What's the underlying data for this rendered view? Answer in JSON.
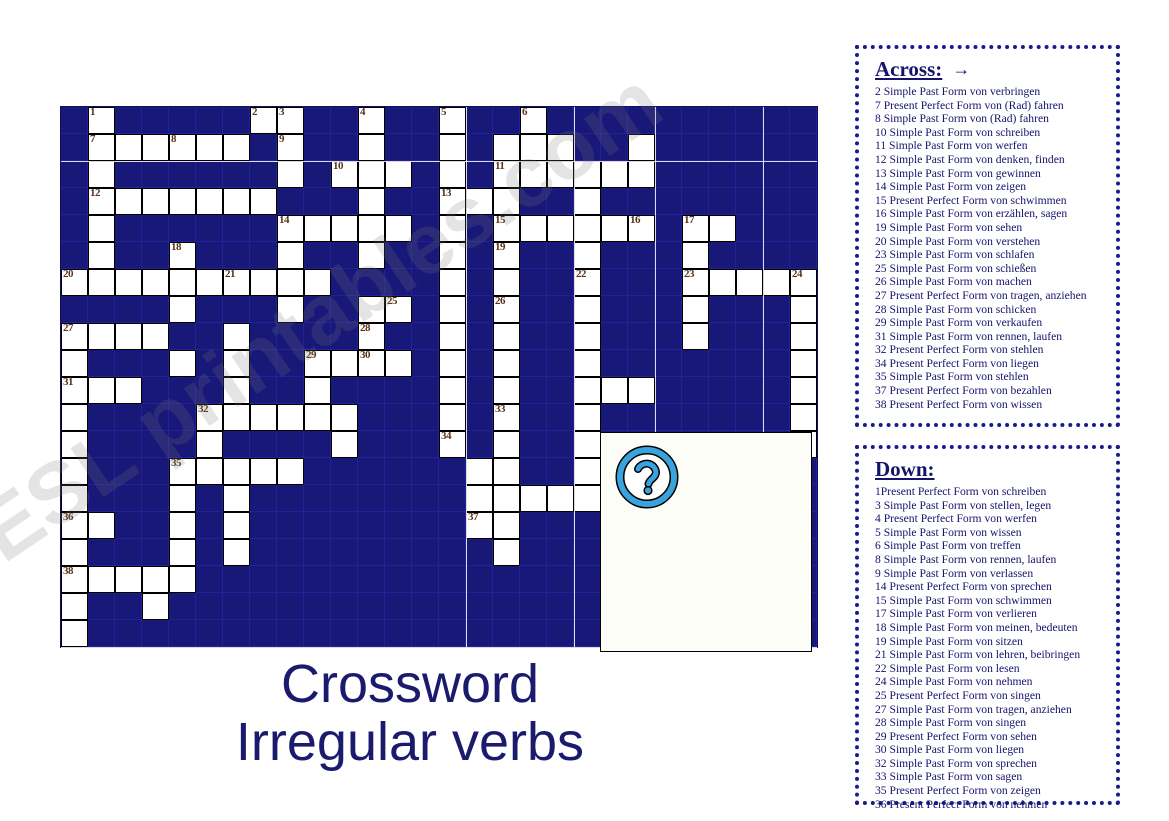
{
  "title": {
    "line1": "Crossword",
    "line2": "Irregular verbs"
  },
  "watermark": "ESL printables.com",
  "grid": {
    "columns": 28,
    "rows": 20,
    "cell_size": 27,
    "blocked_color": "#181878",
    "open_color": "#ffffff",
    "number_color": "#5a3318",
    "open_cells": [
      [
        0,
        1
      ],
      [
        0,
        7
      ],
      [
        0,
        8
      ],
      [
        0,
        11
      ],
      [
        0,
        14
      ],
      [
        0,
        17
      ],
      [
        1,
        1
      ],
      [
        1,
        2
      ],
      [
        1,
        3
      ],
      [
        1,
        4
      ],
      [
        1,
        5
      ],
      [
        1,
        6
      ],
      [
        1,
        8
      ],
      [
        1,
        11
      ],
      [
        1,
        14
      ],
      [
        1,
        16
      ],
      [
        1,
        17
      ],
      [
        1,
        18
      ],
      [
        1,
        21
      ],
      [
        2,
        1
      ],
      [
        2,
        8
      ],
      [
        2,
        10
      ],
      [
        2,
        11
      ],
      [
        2,
        12
      ],
      [
        2,
        14
      ],
      [
        2,
        16
      ],
      [
        2,
        17
      ],
      [
        2,
        18
      ],
      [
        2,
        19
      ],
      [
        2,
        20
      ],
      [
        2,
        21
      ],
      [
        3,
        1
      ],
      [
        3,
        2
      ],
      [
        3,
        3
      ],
      [
        3,
        4
      ],
      [
        3,
        5
      ],
      [
        3,
        6
      ],
      [
        3,
        7
      ],
      [
        3,
        11
      ],
      [
        3,
        14
      ],
      [
        3,
        15
      ],
      [
        3,
        16
      ],
      [
        3,
        19
      ],
      [
        4,
        1
      ],
      [
        4,
        8
      ],
      [
        4,
        9
      ],
      [
        4,
        10
      ],
      [
        4,
        11
      ],
      [
        4,
        12
      ],
      [
        4,
        14
      ],
      [
        4,
        16
      ],
      [
        4,
        17
      ],
      [
        4,
        18
      ],
      [
        4,
        19
      ],
      [
        4,
        20
      ],
      [
        4,
        21
      ],
      [
        4,
        23
      ],
      [
        4,
        24
      ],
      [
        5,
        1
      ],
      [
        5,
        4
      ],
      [
        5,
        8
      ],
      [
        5,
        11
      ],
      [
        5,
        14
      ],
      [
        5,
        16
      ],
      [
        5,
        19
      ],
      [
        5,
        23
      ],
      [
        6,
        0
      ],
      [
        6,
        1
      ],
      [
        6,
        2
      ],
      [
        6,
        3
      ],
      [
        6,
        4
      ],
      [
        6,
        5
      ],
      [
        6,
        6
      ],
      [
        6,
        7
      ],
      [
        6,
        8
      ],
      [
        6,
        9
      ],
      [
        6,
        14
      ],
      [
        6,
        16
      ],
      [
        6,
        19
      ],
      [
        6,
        23
      ],
      [
        6,
        24
      ],
      [
        6,
        25
      ],
      [
        6,
        26
      ],
      [
        6,
        27
      ],
      [
        7,
        4
      ],
      [
        7,
        8
      ],
      [
        7,
        11
      ],
      [
        7,
        12
      ],
      [
        7,
        14
      ],
      [
        7,
        16
      ],
      [
        7,
        19
      ],
      [
        7,
        23
      ],
      [
        7,
        27
      ],
      [
        8,
        0
      ],
      [
        8,
        1
      ],
      [
        8,
        2
      ],
      [
        8,
        3
      ],
      [
        8,
        6
      ],
      [
        8,
        11
      ],
      [
        8,
        14
      ],
      [
        8,
        16
      ],
      [
        8,
        19
      ],
      [
        8,
        23
      ],
      [
        8,
        27
      ],
      [
        9,
        0
      ],
      [
        9,
        4
      ],
      [
        9,
        6
      ],
      [
        9,
        9
      ],
      [
        9,
        10
      ],
      [
        9,
        11
      ],
      [
        9,
        12
      ],
      [
        9,
        14
      ],
      [
        9,
        16
      ],
      [
        9,
        19
      ],
      [
        9,
        27
      ],
      [
        10,
        0
      ],
      [
        10,
        1
      ],
      [
        10,
        2
      ],
      [
        10,
        6
      ],
      [
        10,
        9
      ],
      [
        10,
        14
      ],
      [
        10,
        16
      ],
      [
        10,
        19
      ],
      [
        10,
        20
      ],
      [
        10,
        21
      ],
      [
        10,
        27
      ],
      [
        11,
        0
      ],
      [
        11,
        5
      ],
      [
        11,
        6
      ],
      [
        11,
        7
      ],
      [
        11,
        8
      ],
      [
        11,
        9
      ],
      [
        11,
        10
      ],
      [
        11,
        14
      ],
      [
        11,
        16
      ],
      [
        11,
        19
      ],
      [
        11,
        27
      ],
      [
        12,
        0
      ],
      [
        12,
        5
      ],
      [
        12,
        10
      ],
      [
        12,
        14
      ],
      [
        12,
        16
      ],
      [
        12,
        19
      ],
      [
        12,
        27
      ],
      [
        13,
        0
      ],
      [
        13,
        4
      ],
      [
        13,
        5
      ],
      [
        13,
        6
      ],
      [
        13,
        7
      ],
      [
        13,
        8
      ],
      [
        13,
        15
      ],
      [
        13,
        16
      ],
      [
        13,
        19
      ],
      [
        14,
        0
      ],
      [
        14,
        4
      ],
      [
        14,
        6
      ],
      [
        14,
        15
      ],
      [
        14,
        16
      ],
      [
        14,
        17
      ],
      [
        14,
        18
      ],
      [
        14,
        19
      ],
      [
        15,
        0
      ],
      [
        15,
        1
      ],
      [
        15,
        4
      ],
      [
        15,
        6
      ],
      [
        15,
        15
      ],
      [
        15,
        16
      ],
      [
        16,
        0
      ],
      [
        16,
        4
      ],
      [
        16,
        6
      ],
      [
        16,
        16
      ],
      [
        17,
        0
      ],
      [
        17,
        1
      ],
      [
        17,
        2
      ],
      [
        17,
        3
      ],
      [
        17,
        4
      ],
      [
        18,
        0
      ],
      [
        18,
        3
      ],
      [
        19,
        0
      ]
    ],
    "numbers": [
      {
        "r": 0,
        "c": 1,
        "n": "1"
      },
      {
        "r": 0,
        "c": 7,
        "n": "2"
      },
      {
        "r": 0,
        "c": 8,
        "n": "3"
      },
      {
        "r": 0,
        "c": 11,
        "n": "4"
      },
      {
        "r": 0,
        "c": 14,
        "n": "5"
      },
      {
        "r": 0,
        "c": 17,
        "n": "6"
      },
      {
        "r": 1,
        "c": 1,
        "n": "7"
      },
      {
        "r": 1,
        "c": 4,
        "n": "8"
      },
      {
        "r": 1,
        "c": 8,
        "n": "9"
      },
      {
        "r": 2,
        "c": 10,
        "n": "10"
      },
      {
        "r": 2,
        "c": 16,
        "n": "11"
      },
      {
        "r": 3,
        "c": 1,
        "n": "12"
      },
      {
        "r": 3,
        "c": 14,
        "n": "13"
      },
      {
        "r": 4,
        "c": 8,
        "n": "14"
      },
      {
        "r": 4,
        "c": 16,
        "n": "15"
      },
      {
        "r": 4,
        "c": 21,
        "n": "16"
      },
      {
        "r": 4,
        "c": 23,
        "n": "17"
      },
      {
        "r": 5,
        "c": 4,
        "n": "18"
      },
      {
        "r": 5,
        "c": 16,
        "n": "19"
      },
      {
        "r": 6,
        "c": 0,
        "n": "20"
      },
      {
        "r": 6,
        "c": 6,
        "n": "21"
      },
      {
        "r": 6,
        "c": 19,
        "n": "22"
      },
      {
        "r": 6,
        "c": 23,
        "n": "23"
      },
      {
        "r": 6,
        "c": 27,
        "n": "24"
      },
      {
        "r": 7,
        "c": 12,
        "n": "25"
      },
      {
        "r": 7,
        "c": 16,
        "n": "26"
      },
      {
        "r": 8,
        "c": 0,
        "n": "27"
      },
      {
        "r": 8,
        "c": 11,
        "n": "28"
      },
      {
        "r": 9,
        "c": 9,
        "n": "29"
      },
      {
        "r": 9,
        "c": 11,
        "n": "30"
      },
      {
        "r": 10,
        "c": 0,
        "n": "31"
      },
      {
        "r": 11,
        "c": 5,
        "n": "32"
      },
      {
        "r": 11,
        "c": 16,
        "n": "33"
      },
      {
        "r": 12,
        "c": 14,
        "n": "34"
      },
      {
        "r": 13,
        "c": 4,
        "n": "35"
      },
      {
        "r": 15,
        "c": 0,
        "n": "36"
      },
      {
        "r": 15,
        "c": 15,
        "n": "37"
      },
      {
        "r": 17,
        "c": 0,
        "n": "38"
      }
    ]
  },
  "question_box": {
    "icon": "question-mark-circle-icon",
    "icon_color": "#3aa3dd"
  },
  "across": {
    "heading": "Across:",
    "arrow": "→",
    "clues": [
      "2 Simple Past  Form von verbringen",
      "7 Present Perfect Form von (Rad) fahren",
      "8 Simple Past  Form von (Rad) fahren",
      "10 Simple Past  Form von schreiben",
      "11 Simple Past  Form von werfen",
      "12 Simple Past  Form von denken, finden",
      "13 Simple Past  Form von gewinnen",
      "14 Simple Past  Form von zeigen",
      "15 Present  Perfect Form von schwimmen",
      "16 Simple Past  Form von erzählen, sagen",
      "19 Simple Past  Form von sehen",
      "20 Simple Past  Form von verstehen",
      "23 Simple Past  Form von schlafen",
      "25 Simple Past  Form von schießen",
      "26 Simple Past  Form von machen",
      "27 Present Perfect  Form von tragen, anziehen",
      "28 Simple Past  Form von schicken",
      "29 Simple Past  Form von verkaufen",
      "31 Simple Past  Form von rennen, laufen",
      "32 Present  Perfect Form von stehlen",
      "34 Present  Perfect Form von liegen",
      "35 Simple Past  Form von stehlen",
      "37 Present  Perfect Form von bezahlen",
      "38 Present  Perfect Form von wissen"
    ]
  },
  "down": {
    "heading": "Down:",
    "clues": [
      "1Present Perfect Form von schreiben",
      "3 Simple Past  Form von stellen, legen",
      "4 Present Perfect Form von werfen",
      "5 Simple Past  Form von wissen",
      "6 Simple Past  Form von treffen",
      "8 Simple Past  Form von rennen, laufen",
      "9 Simple Past  Form von verlassen",
      "14 Present Perfect Form von sprechen",
      "15 Simple Past  Form von schwimmen",
      "17 Simple Past  Form von verlieren",
      "18 Simple Past  Form von meinen, bedeuten",
      "19 Simple Past  Form von sitzen",
      "21 Simple Past  Form von lehren, beibringen",
      "22 Simple Past  Form von lesen",
      "24 Simple Past  Form von nehmen",
      "25 Present Perfect Form von singen",
      "27 Simple Past  Form von tragen, anziehen",
      "28 Simple Past  Form von singen",
      "29 Present Perfect Form von sehen",
      "30 Simple Past  Form von liegen",
      "32 Simple Past  Form von sprechen",
      "33 Simple Past  Form von sagen",
      "35 Present Perfect Form von zeigen",
      "36 Present Perfect Form von nehmen"
    ]
  }
}
